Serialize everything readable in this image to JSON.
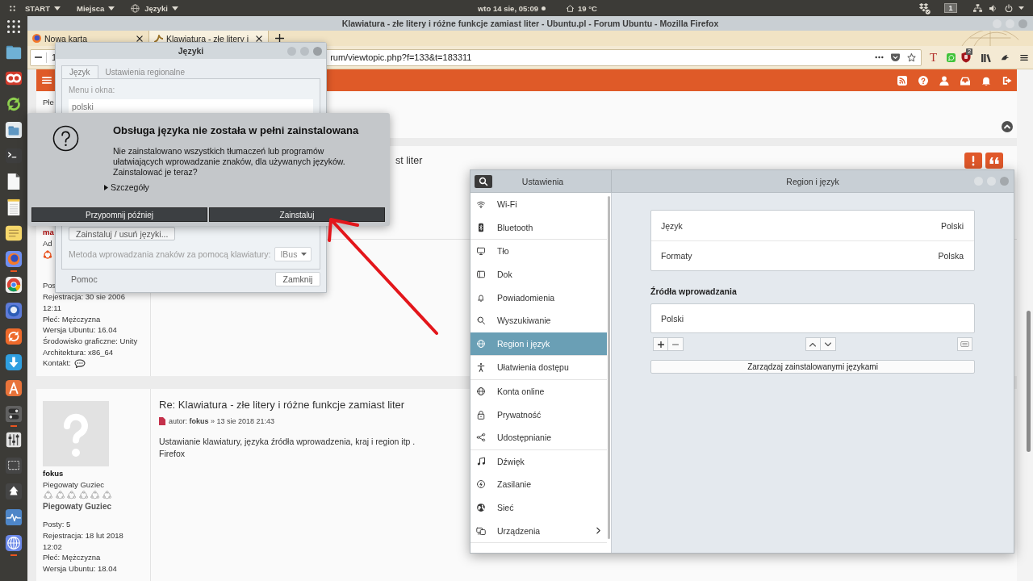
{
  "top_panel": {
    "menus": [
      {
        "label": "START"
      },
      {
        "label": "Miejsca"
      },
      {
        "label": "Języki"
      }
    ],
    "clock": "wto 14 sie, 05:09",
    "temperature": "19 °C",
    "workspace": "1"
  },
  "dock": [
    {
      "running": false
    },
    {
      "running": false
    },
    {
      "running": false
    },
    {
      "running": false
    },
    {
      "running": false
    },
    {
      "running": false
    },
    {
      "running": false
    },
    {
      "running": false
    },
    {
      "running": false
    },
    {
      "running": true
    },
    {
      "running": false
    },
    {
      "running": false
    },
    {
      "running": false
    },
    {
      "running": false
    },
    {
      "running": false
    },
    {
      "running": true
    },
    {
      "running": false
    },
    {
      "running": false
    },
    {
      "running": false
    },
    {
      "running": false
    },
    {
      "running": true
    }
  ],
  "browser": {
    "title": "Klawiatura - złe litery i różne funkcje zamiast liter - Ubuntu.pl - Forum Ubuntu - Mozilla Firefox",
    "tabs": [
      {
        "label": "Nowa karta",
        "selected": false
      },
      {
        "label": "Klawiatura - złe litery i",
        "selected": true
      }
    ],
    "zoom": "1",
    "url": "rum/viewtopic.php?f=133&t=183311",
    "extension_letter": "T",
    "extension_badge": "2"
  },
  "forum": {
    "top_post": {
      "profile_lines": [
        "Płe"
      ]
    },
    "post": {
      "title": "st liter",
      "username": "ma",
      "rank": "Ad",
      "profile_lines": [
        "Pos",
        "Rejestracja: 30 sie 2006",
        "12:11",
        "Płeć: Mężczyzna",
        "Wersja Ubuntu: 16.04",
        "Środowisko graficzne: Unity",
        "Architektura: x86_64"
      ],
      "contact_label": "Kontakt:"
    },
    "reply": {
      "username": "fokus",
      "rank": "Piegowaty Guziec",
      "rank_title": "Piegowaty Guziec",
      "profile_lines": [
        "Posty: 5",
        "Rejestracja: 18 lut 2018",
        "12:02",
        "Płeć: Mężczyzna",
        "Wersja Ubuntu: 18.04"
      ],
      "title": "Re: Klawiatura - złe litery i różne funkcje zamiast liter",
      "meta": "autor: **fokus** » 13 sie 2018 21:43",
      "body": "Ustawianie klawiatury, języka źródła wprowadzenia, kraj i region itp .\nFirefox"
    }
  },
  "settings": {
    "sidebar_title": "Ustawienia",
    "title": "Region i język",
    "sidebar": {
      "groups": [
        {
          "items": [
            {
              "label": "Wi-Fi",
              "selected": false,
              "submenu": false
            },
            {
              "label": "Bluetooth",
              "selected": false,
              "submenu": false
            }
          ]
        },
        {
          "items": [
            {
              "label": "Tło",
              "selected": false,
              "submenu": false
            },
            {
              "label": "Dok",
              "selected": false,
              "submenu": false
            },
            {
              "label": "Powiadomienia",
              "selected": false,
              "submenu": false
            },
            {
              "label": "Wyszukiwanie",
              "selected": false,
              "submenu": false
            },
            {
              "label": "Region i język",
              "selected": true,
              "submenu": false
            }
          ]
        },
        {
          "items": [
            {
              "label": "Ułatwienia dostępu",
              "selected": false,
              "submenu": false
            }
          ]
        },
        {
          "items": [
            {
              "label": "Konta online",
              "selected": false,
              "submenu": false
            },
            {
              "label": "Prywatność",
              "selected": false,
              "submenu": false
            },
            {
              "label": "Udostępnianie",
              "selected": false,
              "submenu": false
            }
          ]
        },
        {
          "items": [
            {
              "label": "Dźwięk",
              "selected": false,
              "submenu": false
            },
            {
              "label": "Zasilanie",
              "selected": false,
              "submenu": false
            },
            {
              "label": "Sieć",
              "selected": false,
              "submenu": false
            },
            {
              "label": "Urządzenia",
              "selected": false,
              "submenu": true
            }
          ]
        }
      ]
    },
    "region": {
      "rows": [
        {
          "label": "Język",
          "value": "Polski"
        },
        {
          "label": "Formaty",
          "value": "Polska"
        }
      ]
    },
    "input_sources": {
      "heading": "Źródła wprowadzania",
      "items": [
        "Polski"
      ]
    },
    "manage_button": "Zarządzaj zainstalowanymi językami"
  },
  "languages_dialog": {
    "title": "Języki",
    "tabs": [
      {
        "label": "Język",
        "selected": true
      },
      {
        "label": "Ustawienia regionalne",
        "selected": false
      }
    ],
    "menu_label": "Menu i okna:",
    "languages": [
      "polski"
    ],
    "install_button": "Zainstaluj / usuń języki...",
    "input_method_label": "Metoda wprowadzania znaków za pomocą klawiatury:",
    "input_method": "IBus",
    "help_button": "Pomoc",
    "close_button": "Zamknij"
  },
  "install_prompt": {
    "title": "Obsługa języka nie została w pełni zainstalowana",
    "message": "Nie zainstalowano wszystkich tłumaczeń lub programów\nułatwiających wprowadzanie znaków, dla używanych języków.\nZainstalować je teraz?",
    "details": {
      "label": "Szczegóły",
      "expanded": false
    },
    "buttons": [
      "Przypomnij później",
      "Zainstaluj"
    ]
  }
}
